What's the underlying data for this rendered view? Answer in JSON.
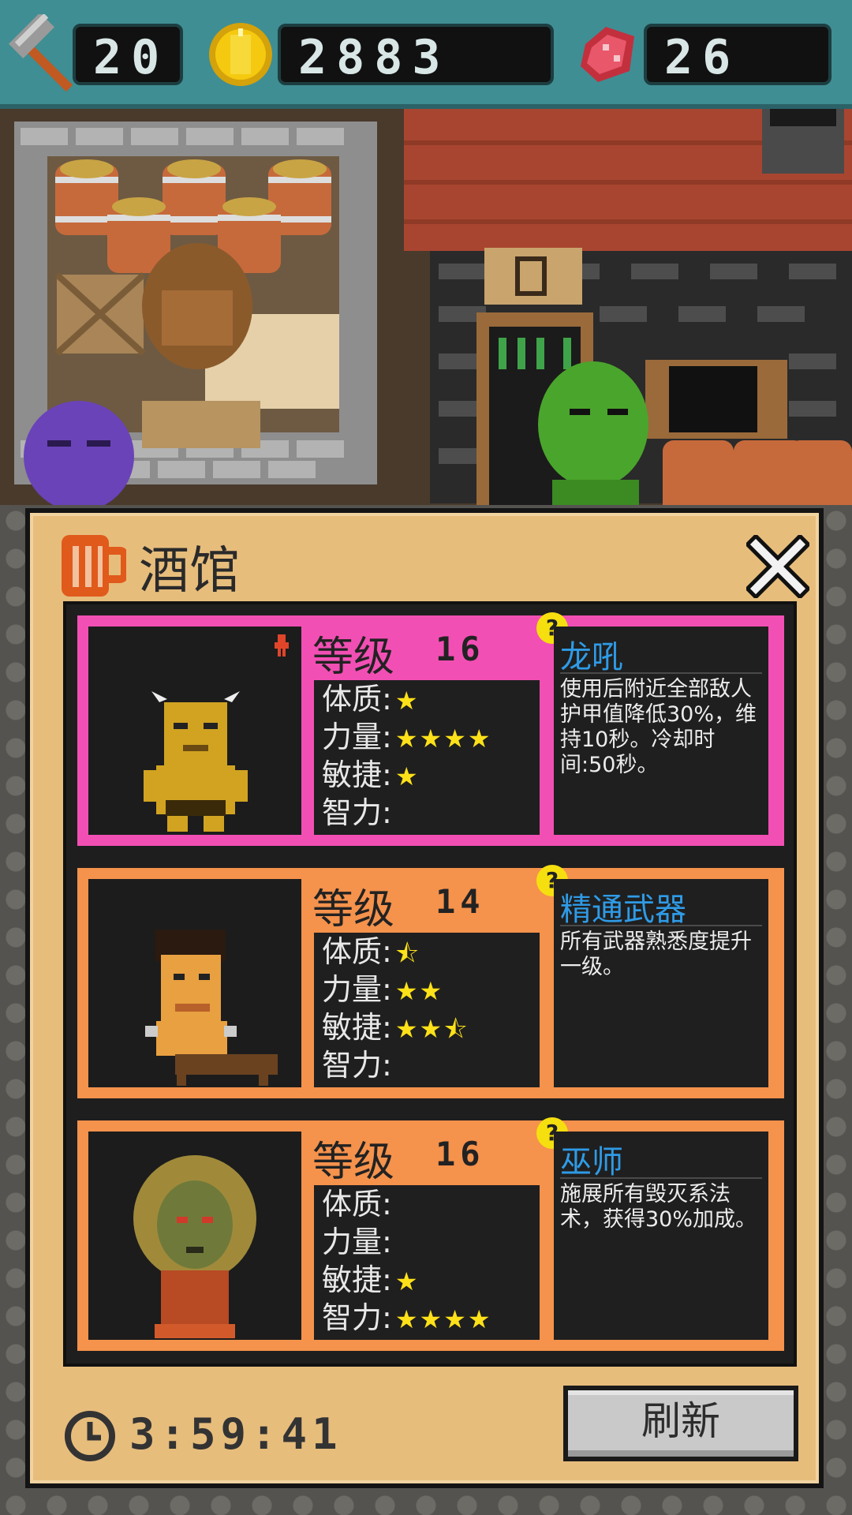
{
  "resources": {
    "hammers": "20",
    "gold": "2883",
    "meat": "26"
  },
  "tavern": {
    "title": "酒馆",
    "timer": "3:59:41",
    "refresh_label": "刷新"
  },
  "stat_labels": {
    "con": "体质:",
    "str": "力量:",
    "agi": "敏捷:",
    "int": "智力:"
  },
  "heroes": [
    {
      "level_label": "等级",
      "level": "16",
      "frame_color": "#f24fb4",
      "stars": {
        "con": "★",
        "str": "★★★★",
        "agi": "★",
        "int": ""
      },
      "skill_name": "龙吼",
      "skill_desc": "使用后附近全部敌人护甲值降低30%，维持10秒。冷却时间:50秒。"
    },
    {
      "level_label": "等级",
      "level": "14",
      "frame_color": "#f5924c",
      "stars": {
        "con": "⯪",
        "str": "★★",
        "agi": "★★⯪",
        "int": ""
      },
      "skill_name": "精通武器",
      "skill_desc": "所有武器熟悉度提升一级。"
    },
    {
      "level_label": "等级",
      "level": "16",
      "frame_color": "#f5924c",
      "stars": {
        "con": "",
        "str": "",
        "agi": "★",
        "int": "★★★★"
      },
      "skill_name": "巫师",
      "skill_desc": "施展所有毁灭系法术，获得30%加成。"
    }
  ],
  "colors": {
    "topbar": "#3f8e93",
    "panel": "#e7bd7c",
    "star": "#ffe119",
    "skill_name": "#2f9be6",
    "help": "#f6df0f"
  },
  "icons": [
    "hammer-icon",
    "gold-coin-icon",
    "meat-icon",
    "beer-mug-icon",
    "close-icon",
    "help-icon",
    "clock-icon",
    "strength-buff-icon"
  ]
}
